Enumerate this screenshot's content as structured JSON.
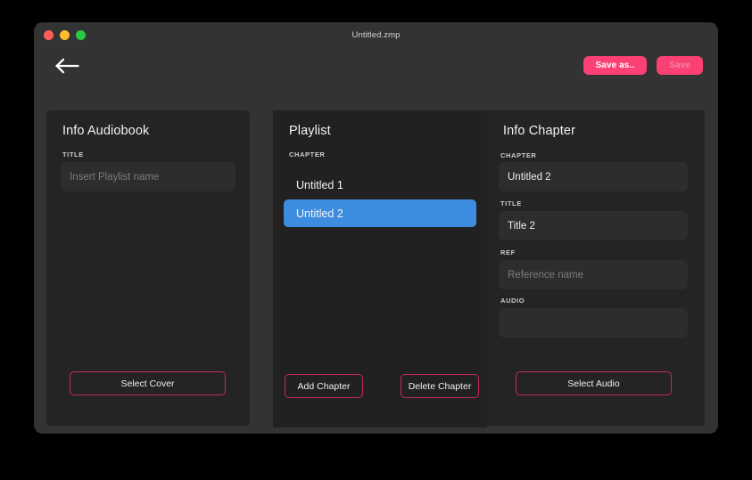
{
  "window": {
    "title": "Untitled.zmp",
    "traffic_lights": [
      "close",
      "minimize",
      "maximize"
    ]
  },
  "toolbar": {
    "back_icon": "arrow-left-icon",
    "save_as_label": "Save as..",
    "save_label": "Save"
  },
  "colors": {
    "accent_pink": "#fb4074",
    "accent_pink_disabled_text": "#f486a6",
    "outline_pink": "#c22a5d",
    "selection_blue": "#3d8ce0",
    "window_bg": "#333333",
    "panel_bg": "#242424",
    "panel_bg_alt": "#212121",
    "input_bg": "#2d2d2d"
  },
  "panels": {
    "info_audiobook": {
      "title": "Info Audiobook",
      "title_label": "TITLE",
      "title_value": "",
      "title_placeholder": "Insert Playlist name",
      "select_cover_label": "Select Cover"
    },
    "playlist": {
      "title": "Playlist",
      "chapter_label": "CHAPTER",
      "chapters": [
        {
          "label": "Untitled 1",
          "selected": false
        },
        {
          "label": "Untitled 2",
          "selected": true
        }
      ],
      "add_chapter_label": "Add Chapter",
      "delete_chapter_label": "Delete Chapter"
    },
    "info_chapter": {
      "title": "Info Chapter",
      "chapter_label": "CHAPTER",
      "chapter_value": "Untitled 2",
      "chapter_placeholder": "",
      "title_label": "TITLE",
      "title_value": "Title 2",
      "title_placeholder": "",
      "ref_label": "REF",
      "ref_value": "",
      "ref_placeholder": "Reference name",
      "audio_label": "AUDIO",
      "audio_value": "",
      "audio_placeholder": "",
      "select_audio_label": "Select Audio"
    }
  }
}
